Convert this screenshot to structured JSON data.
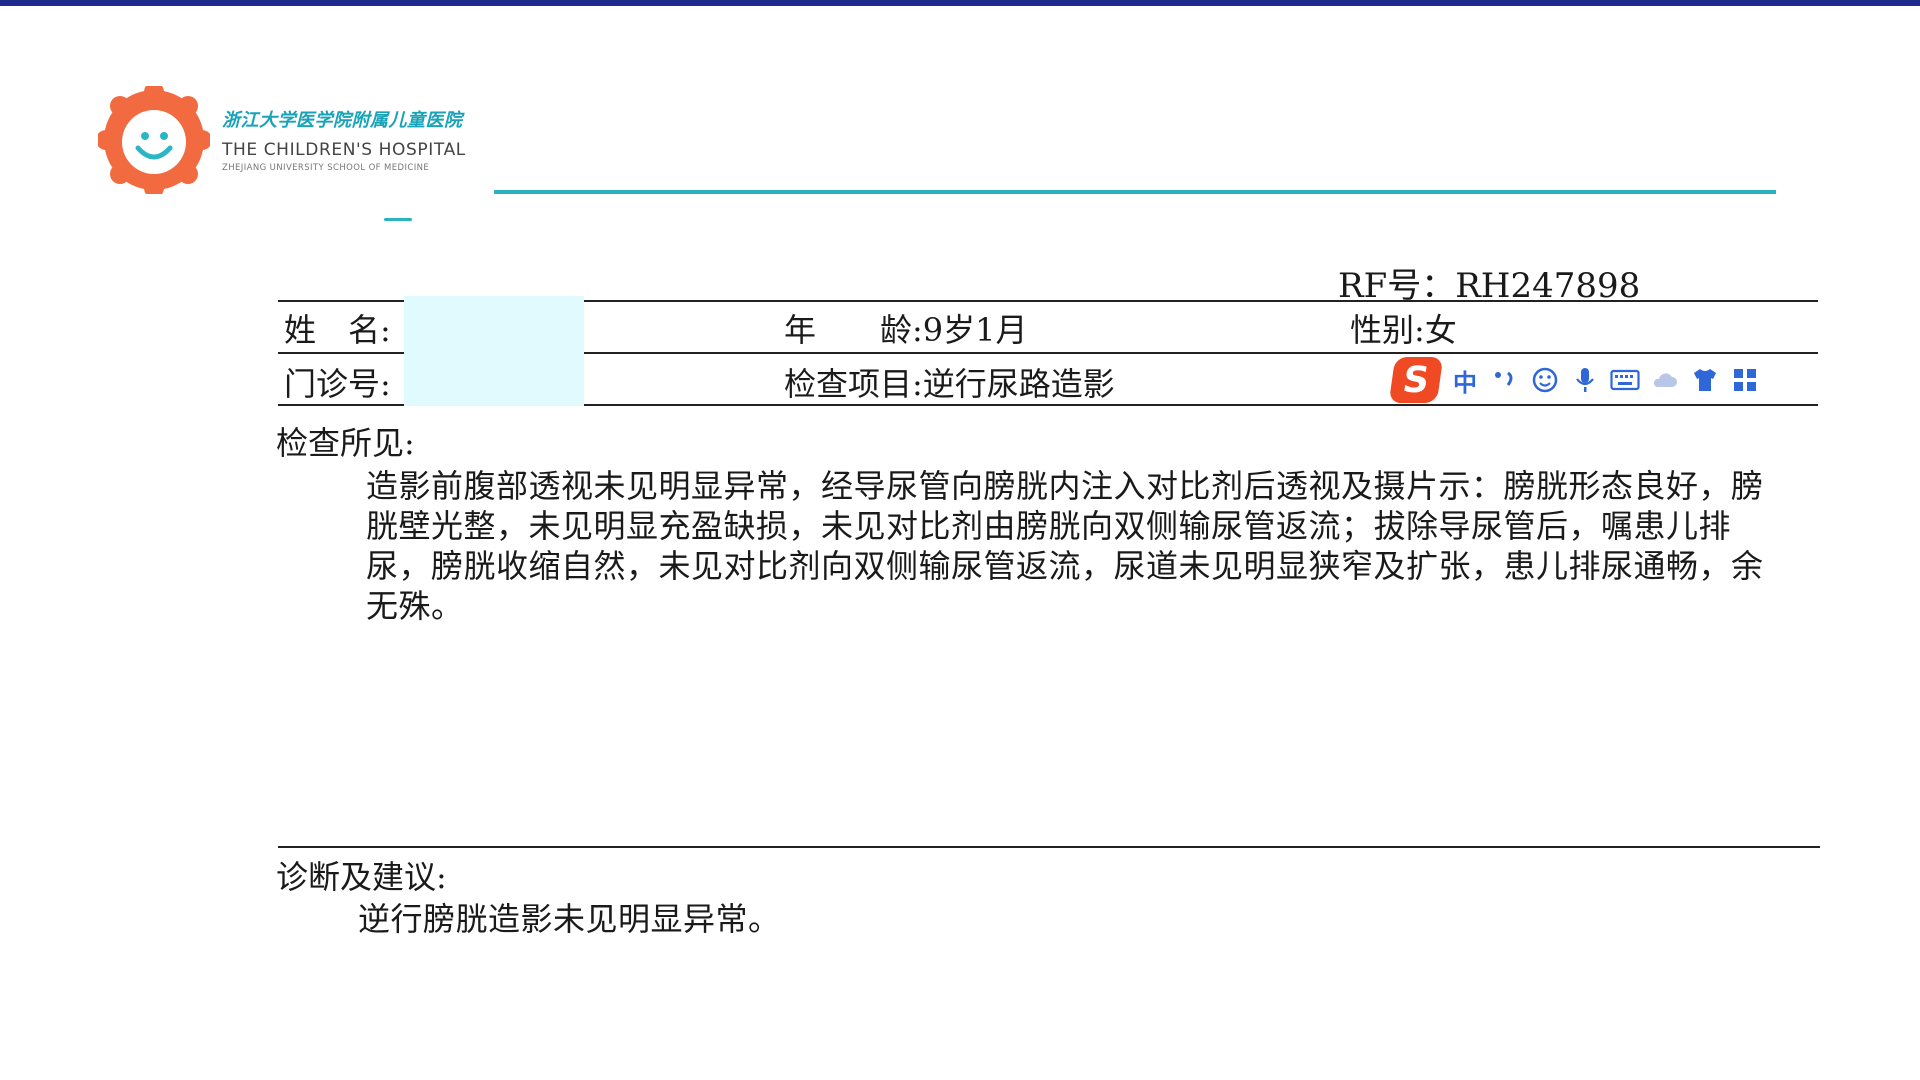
{
  "header": {
    "hospital_name_cn": "浙江大学医学院附属儿童医院",
    "hospital_name_en": "THE CHILDREN'S HOSPITAL",
    "hospital_name_en_sub": "ZHEJIANG UNIVERSITY SCHOOL OF MEDICINE",
    "logo_icon": "smiling-sun-logo",
    "brand_color": "#29b3c0",
    "logo_color": "#f26a3f"
  },
  "report": {
    "rf_label": "RF号：",
    "rf_value": "RH247898",
    "name_label": "姓　名:",
    "name_value": "",
    "age_label": "年　　龄:",
    "age_value": "9岁1月",
    "gender_label": "性别:",
    "gender_value": "女",
    "clinic_label": "门诊号:",
    "clinic_value": "",
    "exam_label": "检查项目:",
    "exam_value": "逆行尿路造影",
    "findings_title": "检查所见:",
    "findings_text": "造影前腹部透视未见明显异常，经导尿管向膀胱内注入对比剂后透视及摄片示：膀胱形态良好，膀胱壁光整，未见明显充盈缺损，未见对比剂由膀胱向双侧输尿管返流；拔除导尿管后，嘱患儿排尿，膀胱收缩自然，未见对比剂向双侧输尿管返流，尿道未见明显狭窄及扩张，患儿排尿通畅，余无殊。",
    "conclusion_title": "诊断及建议:",
    "conclusion_text": "逆行膀胱造影未见明显异常。"
  },
  "ime_toolbar": {
    "mode_label": "中",
    "icons": [
      "sogou-logo-icon",
      "punctuation-icon",
      "emoji-icon",
      "microphone-icon",
      "keyboard-icon",
      "cloud-icon",
      "skin-shirt-icon",
      "toolbox-grid-icon"
    ]
  }
}
